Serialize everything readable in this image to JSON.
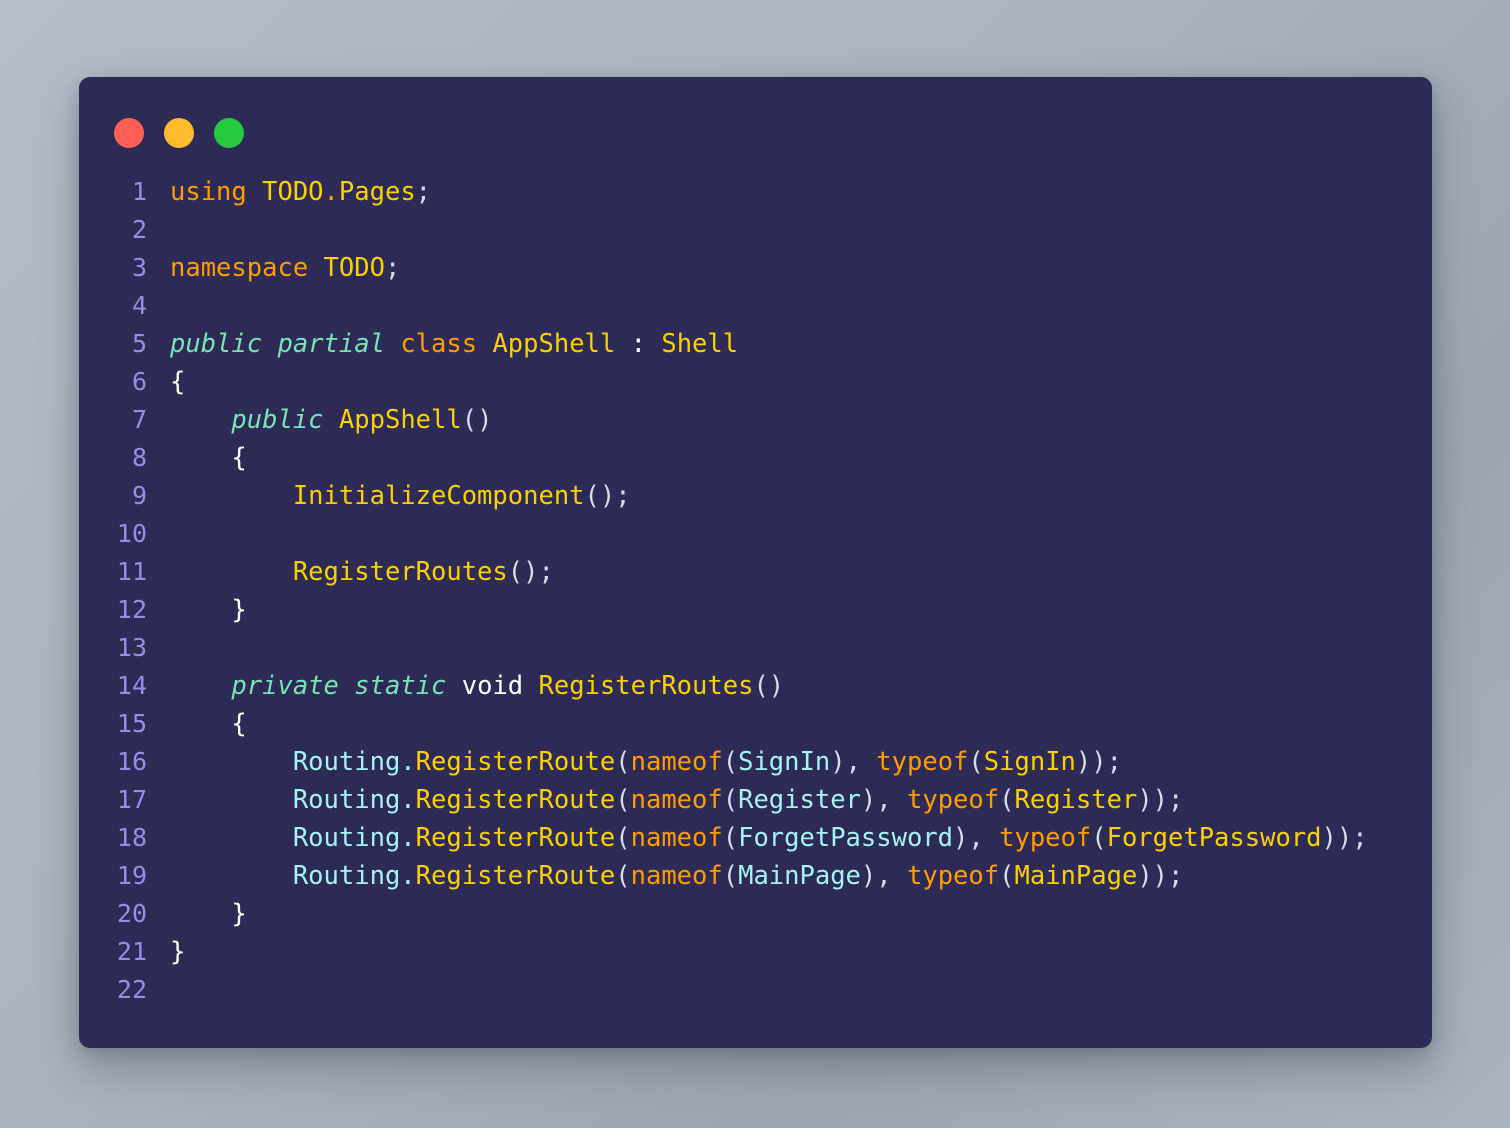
{
  "window": {
    "title_bar": {
      "buttons": [
        {
          "name": "close-button",
          "label": "",
          "color": "#ff5f56"
        },
        {
          "name": "minimize-button",
          "label": "",
          "color": "#ffbd2e"
        },
        {
          "name": "maximize-button",
          "label": "",
          "color": "#27c93f"
        }
      ]
    },
    "background_color": "#2d2b55",
    "linenumber_color": "#9a8ce6"
  },
  "editor": {
    "language": "csharp",
    "total_lines": 22,
    "line_numbers": [
      "1",
      "2",
      "3",
      "4",
      "5",
      "6",
      "7",
      "8",
      "9",
      "10",
      "11",
      "12",
      "13",
      "14",
      "15",
      "16",
      "17",
      "18",
      "19",
      "20",
      "21",
      "22"
    ],
    "lines": [
      {
        "number": "1",
        "text": "using TODO.Pages;"
      },
      {
        "number": "2",
        "text": ""
      },
      {
        "number": "3",
        "text": "namespace TODO;"
      },
      {
        "number": "4",
        "text": ""
      },
      {
        "number": "5",
        "text": "public partial class AppShell : Shell"
      },
      {
        "number": "6",
        "text": "{"
      },
      {
        "number": "7",
        "text": "    public AppShell()"
      },
      {
        "number": "8",
        "text": "    {"
      },
      {
        "number": "9",
        "text": "        InitializeComponent();"
      },
      {
        "number": "10",
        "text": ""
      },
      {
        "number": "11",
        "text": "        RegisterRoutes();"
      },
      {
        "number": "12",
        "text": "    }"
      },
      {
        "number": "13",
        "text": ""
      },
      {
        "number": "14",
        "text": "    private static void RegisterRoutes()"
      },
      {
        "number": "15",
        "text": "    {"
      },
      {
        "number": "16",
        "text": "        Routing.RegisterRoute(nameof(SignIn), typeof(SignIn));"
      },
      {
        "number": "17",
        "text": "        Routing.RegisterRoute(nameof(Register), typeof(Register));"
      },
      {
        "number": "18",
        "text": "        Routing.RegisterRoute(nameof(ForgetPassword), typeof(ForgetPassword));"
      },
      {
        "number": "19",
        "text": "        Routing.RegisterRoute(nameof(MainPage), typeof(MainPage));"
      },
      {
        "number": "20",
        "text": "    }"
      },
      {
        "number": "21",
        "text": "}"
      },
      {
        "number": "22",
        "text": ""
      }
    ],
    "tokens": {
      "l1": {
        "using": "using",
        "sp": " ",
        "todo": "TODO",
        "dot": ".",
        "pages": "Pages",
        "semi": ";"
      },
      "l3": {
        "namespace": "namespace",
        "sp": " ",
        "todo": "TODO",
        "semi": ";"
      },
      "l5": {
        "public": "public",
        "sp1": " ",
        "partial": "partial",
        "sp2": " ",
        "class": "class",
        "sp3": " ",
        "appshell": "AppShell",
        "sp4": " ",
        "colon": ":",
        "sp5": " ",
        "shell": "Shell"
      },
      "l6": {
        "brace": "{"
      },
      "l7": {
        "indent": "    ",
        "public": "public",
        "sp": " ",
        "appshell": "AppShell",
        "parens": "()"
      },
      "l8": {
        "indent": "    ",
        "brace": "{"
      },
      "l9": {
        "indent": "        ",
        "fn": "InitializeComponent",
        "parens": "()",
        "semi": ";"
      },
      "l11": {
        "indent": "        ",
        "fn": "RegisterRoutes",
        "parens": "()",
        "semi": ";"
      },
      "l12": {
        "indent": "    ",
        "brace": "}"
      },
      "l14": {
        "indent": "    ",
        "private": "private",
        "sp1": " ",
        "static": "static",
        "sp2": " ",
        "void": "void",
        "sp3": " ",
        "fn": "RegisterRoutes",
        "parens": "()"
      },
      "l15": {
        "indent": "    ",
        "brace": "{"
      },
      "l16": {
        "indent": "        ",
        "obj": "Routing",
        "dot": ".",
        "fn": "RegisterRoute",
        "open": "(",
        "nameof": "nameof",
        "nopen": "(",
        "narg": "SignIn",
        "nclose": ")",
        "comma": ", ",
        "typeof": "typeof",
        "topen": "(",
        "targ": "SignIn",
        "tclose": ")",
        "close": ")",
        "semi": ";"
      },
      "l17": {
        "indent": "        ",
        "obj": "Routing",
        "dot": ".",
        "fn": "RegisterRoute",
        "open": "(",
        "nameof": "nameof",
        "nopen": "(",
        "narg": "Register",
        "nclose": ")",
        "comma": ", ",
        "typeof": "typeof",
        "topen": "(",
        "targ": "Register",
        "tclose": ")",
        "close": ")",
        "semi": ";"
      },
      "l18": {
        "indent": "        ",
        "obj": "Routing",
        "dot": ".",
        "fn": "RegisterRoute",
        "open": "(",
        "nameof": "nameof",
        "nopen": "(",
        "narg": "ForgetPassword",
        "nclose": ")",
        "comma": ", ",
        "typeof": "typeof",
        "topen": "(",
        "targ": "ForgetPassword",
        "tclose": ")",
        "close": ")",
        "semi": ";"
      },
      "l19": {
        "indent": "        ",
        "obj": "Routing",
        "dot": ".",
        "fn": "RegisterRoute",
        "open": "(",
        "nameof": "nameof",
        "nopen": "(",
        "narg": "MainPage",
        "nclose": ")",
        "comma": ", ",
        "typeof": "typeof",
        "topen": "(",
        "targ": "MainPage",
        "tclose": ")",
        "close": ")",
        "semi": ";"
      },
      "l20": {
        "indent": "    ",
        "brace": "}"
      },
      "l21": {
        "brace": "}"
      }
    }
  }
}
